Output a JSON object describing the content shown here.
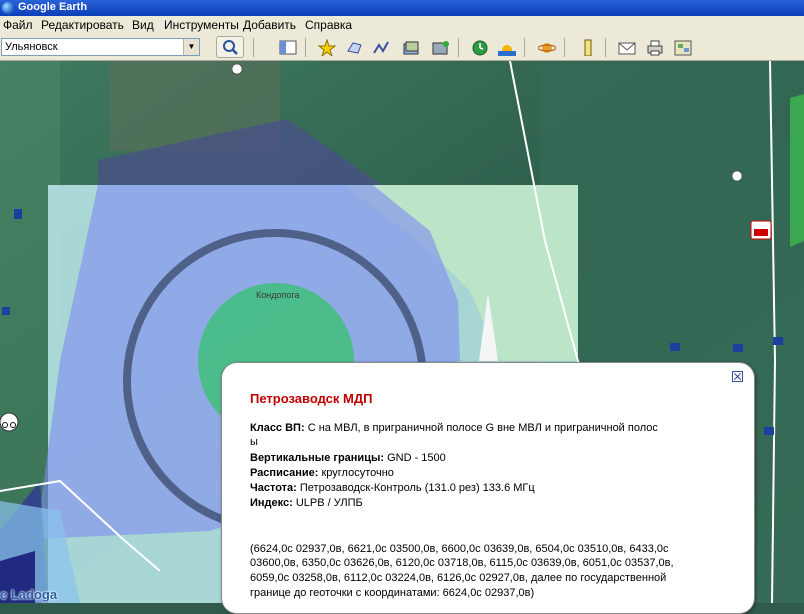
{
  "window": {
    "title": "Google Earth"
  },
  "menu": [
    "Файл",
    "Редактировать",
    "Вид",
    "Инструменты",
    "Добавить",
    "Справка"
  ],
  "search": {
    "value": "Ульяновск"
  },
  "toolbar_icons": [
    "sidebar-toggle-icon",
    "placemark-icon",
    "polygon-icon",
    "path-icon",
    "image-overlay-icon",
    "tour-record-icon",
    "historical-imagery-icon",
    "sunlight-icon",
    "planets-icon",
    "ruler-icon",
    "email-icon",
    "print-icon",
    "view-in-maps-icon"
  ],
  "map": {
    "labels": {
      "place": "Кондопога",
      "lake": "e Ladoga"
    }
  },
  "balloon": {
    "title": "Петрозаводск МДП",
    "class_label": "Класс ВП:",
    "class_value": "С на МВЛ, в приграничной полосе G вне МВЛ и приграничной полос",
    "class_wrap": "ы",
    "vertical_label": "Вертикальные границы:",
    "vertical_value": "GND - 1500",
    "schedule_label": "Расписание:",
    "schedule_value": "круглосуточно",
    "freq_label": "Частота:",
    "freq_value": "Петрозаводск-Контроль (131.0 рез) 133.6 МГц",
    "index_label": "Индекс:",
    "index_value": "ULPB / УЛПБ",
    "coords_line1": "(6624,0с 02937,0в, 6621,0с 03500,0в, 6600,0с 03639,0в, 6504,0с 03510,0в, 6433,0с",
    "coords_line2": "03600,0в, 6350,0с 03626,0в, 6120,0с 03718,0в, 6115,0с 03639,0в, 6051,0с 03537,0в,",
    "coords_line3": "6059,0с 03258,0в, 6112,0с 03224,0в, 6126,0с 02927,0в, далее по государственной",
    "coords_line4": "границе до геоточки с координатами: 6624,0с 02937,0в)"
  },
  "colors": {
    "title": "#c00000",
    "airspace_fill": "#7f8cf0",
    "circle": "#3fbf7a"
  }
}
